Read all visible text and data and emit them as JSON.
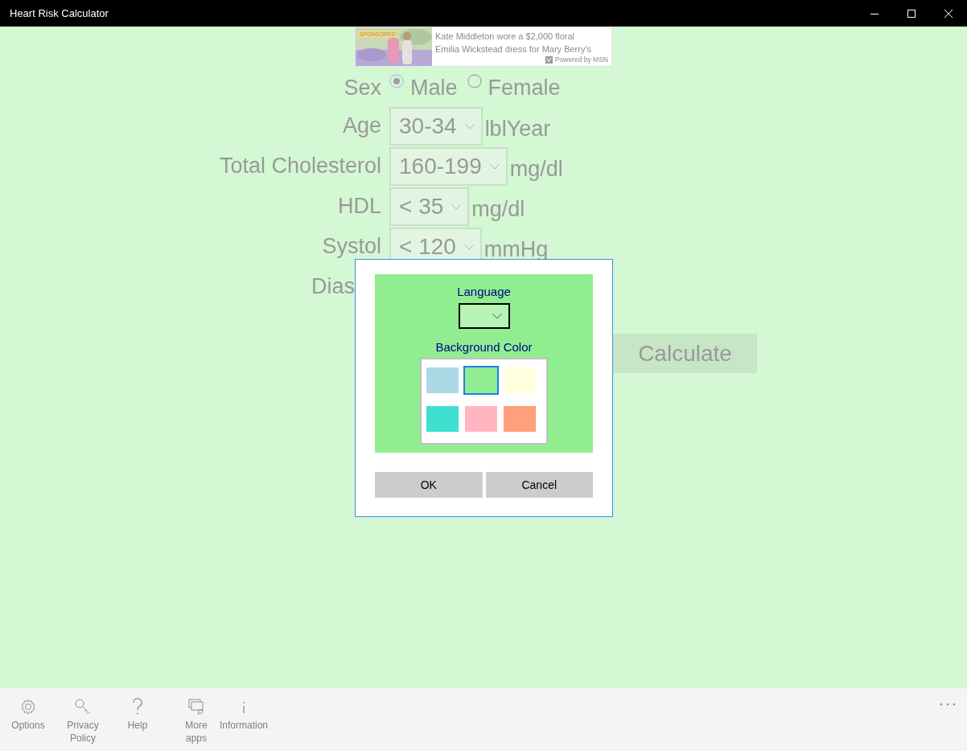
{
  "window": {
    "title": "Heart Risk Calculator"
  },
  "ad": {
    "badge": "SPONSORED",
    "lines": [
      "Kate Middleton wore a $2,000 floral",
      "Emilia Wickstead dress for Mary Berry's"
    ],
    "credit": "Powered by MSN"
  },
  "form": {
    "rows": [
      {
        "kind": "radio",
        "label": "Sex",
        "options": [
          {
            "label": "Male",
            "selected": true
          },
          {
            "label": "Female",
            "selected": false
          }
        ]
      },
      {
        "kind": "select",
        "label": "Age",
        "value": "30-34",
        "unit": "lblYear"
      },
      {
        "kind": "select",
        "label": "Total Cholesterol",
        "value": "160-199",
        "unit": "mg/dl"
      },
      {
        "kind": "select",
        "label": "HDL",
        "value": "< 35",
        "unit": "mg/dl"
      },
      {
        "kind": "select",
        "label": "Systol",
        "value": "< 120",
        "unit": "mmHg"
      },
      {
        "kind": "cut",
        "label": "Dias"
      }
    ],
    "calculate": "Calculate"
  },
  "dialog": {
    "language_label": "Language",
    "color_label": "Background Color",
    "colors": [
      {
        "color": "#add8e6",
        "selected": false
      },
      {
        "color": "#90ee90",
        "selected": true
      },
      {
        "color": "#ffffe0",
        "selected": false
      },
      {
        "color": "#40e0d0",
        "selected": false
      },
      {
        "color": "#ffb6c1",
        "selected": false
      },
      {
        "color": "#ffa07a",
        "selected": false
      }
    ],
    "buttons": [
      "OK",
      "Cancel"
    ]
  },
  "app_bar": [
    {
      "kind": "gear",
      "label": "Options"
    },
    {
      "kind": "key",
      "label": "Privacy Policy"
    },
    {
      "kind": "help",
      "label": "Help"
    },
    {
      "kind": "apps",
      "label": "More apps"
    },
    {
      "kind": "info",
      "label": "Information"
    }
  ]
}
